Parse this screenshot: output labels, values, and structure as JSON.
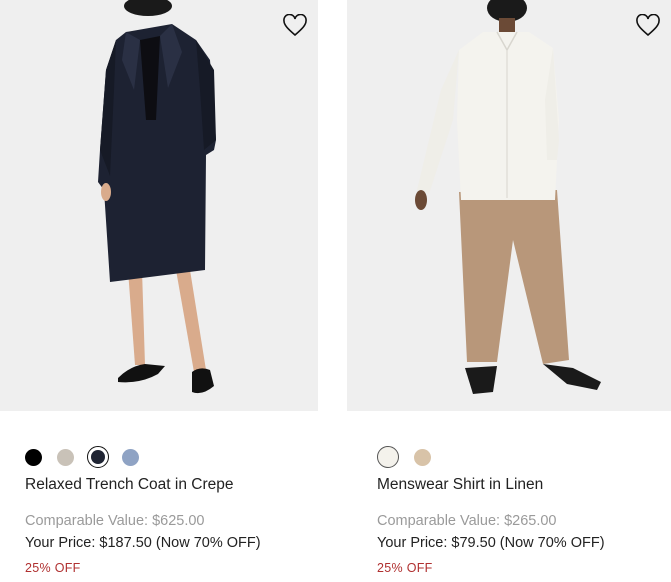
{
  "products": [
    {
      "name": "Relaxed Trench Coat in Crepe",
      "comparable_value": "Comparable Value: $625.00",
      "your_price": "Your Price: $187.50 (Now 70% OFF)",
      "discount_badge": "25% OFF",
      "image_subject": "model wearing navy trench coat",
      "wishlist_icon": "heart-outline-icon",
      "swatches": [
        {
          "color": "#000000",
          "selected": false
        },
        {
          "color": "#c9c2b8",
          "selected": false
        },
        {
          "color": "#1f2433",
          "selected": true
        },
        {
          "color": "#8fa3c4",
          "selected": false
        }
      ]
    },
    {
      "name": "Menswear Shirt in Linen",
      "comparable_value": "Comparable Value: $265.00",
      "your_price": "Your Price: $79.50 (Now 70% OFF)",
      "discount_badge": "25% OFF",
      "image_subject": "model wearing white linen shirt and tan trousers",
      "wishlist_icon": "heart-outline-icon",
      "swatches": [
        {
          "color": "#f4f2ec",
          "selected": true
        },
        {
          "color": "#d8c3a8",
          "selected": false
        }
      ]
    }
  ],
  "colors": {
    "image_background": "#efefef",
    "comparable_text": "#9a9a9a",
    "discount_text": "#b03030",
    "primary_text": "#222222"
  }
}
